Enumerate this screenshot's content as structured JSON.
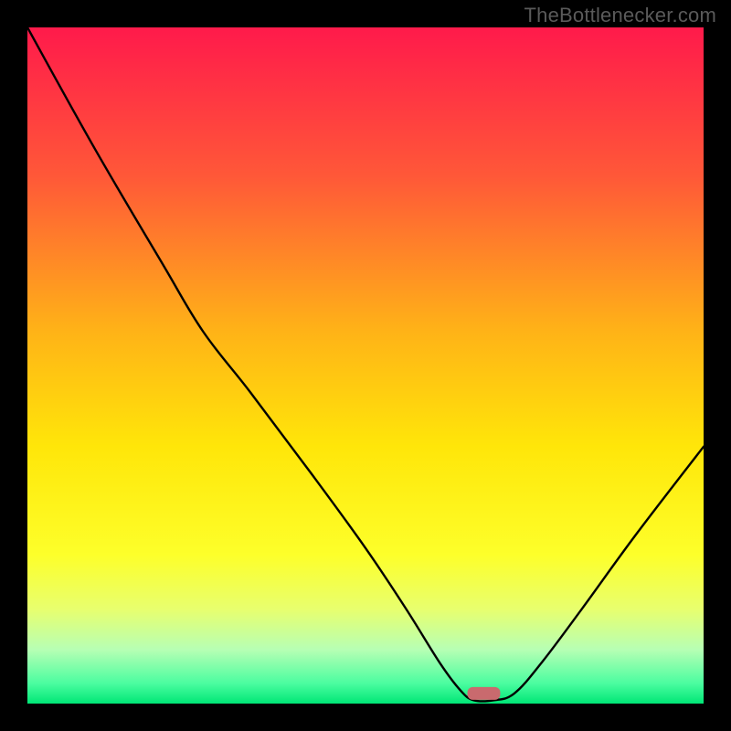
{
  "watermark": "TheBottlenecker.com",
  "chart_data": {
    "type": "line",
    "title": "",
    "xlabel": "",
    "ylabel": "",
    "xlim": [
      0,
      100
    ],
    "ylim": [
      0,
      100
    ],
    "gradient_stops": [
      {
        "offset": 0,
        "color": "#ff1a4b"
      },
      {
        "offset": 22,
        "color": "#ff5838"
      },
      {
        "offset": 45,
        "color": "#ffb317"
      },
      {
        "offset": 62,
        "color": "#ffe609"
      },
      {
        "offset": 78,
        "color": "#fdff2a"
      },
      {
        "offset": 86,
        "color": "#e8ff6e"
      },
      {
        "offset": 92,
        "color": "#b7ffb4"
      },
      {
        "offset": 97,
        "color": "#4bfda0"
      },
      {
        "offset": 100,
        "color": "#00e676"
      }
    ],
    "curve": [
      {
        "x": 0.0,
        "y": 100.0
      },
      {
        "x": 10.0,
        "y": 82.0
      },
      {
        "x": 20.0,
        "y": 65.0
      },
      {
        "x": 26.0,
        "y": 55.0
      },
      {
        "x": 33.0,
        "y": 46.0
      },
      {
        "x": 42.0,
        "y": 34.0
      },
      {
        "x": 50.0,
        "y": 23.0
      },
      {
        "x": 56.0,
        "y": 14.0
      },
      {
        "x": 61.0,
        "y": 6.0
      },
      {
        "x": 64.0,
        "y": 2.0
      },
      {
        "x": 66.0,
        "y": 0.5
      },
      {
        "x": 69.0,
        "y": 0.5
      },
      {
        "x": 72.0,
        "y": 1.5
      },
      {
        "x": 76.0,
        "y": 6.0
      },
      {
        "x": 82.0,
        "y": 14.0
      },
      {
        "x": 90.0,
        "y": 25.0
      },
      {
        "x": 100.0,
        "y": 38.0
      }
    ],
    "marker": {
      "x": 67.5,
      "y": 1.5,
      "color": "#c96a6e"
    }
  }
}
